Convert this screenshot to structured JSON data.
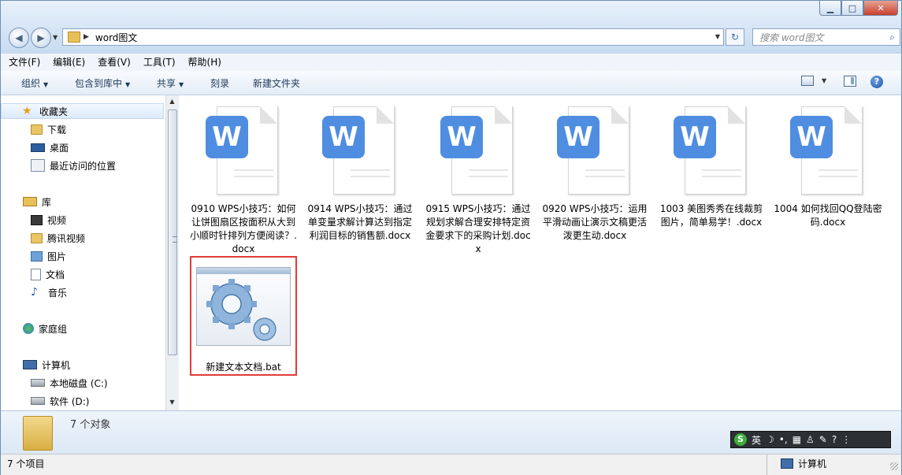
{
  "window": {
    "address": {
      "crumb": "word图文"
    },
    "search": {
      "placeholder": "搜索 word图文"
    }
  },
  "menu": [
    "文件(F)",
    "编辑(E)",
    "查看(V)",
    "工具(T)",
    "帮助(H)"
  ],
  "toolbar": {
    "organize": "组织",
    "include_library": "包含到库中",
    "share": "共享",
    "burn": "刻录",
    "new_folder": "新建文件夹"
  },
  "nav": {
    "favorites": "收藏夹",
    "downloads": "下载",
    "desktop": "桌面",
    "recent": "最近访问的位置",
    "libraries": "库",
    "videos": "视频",
    "tencent_video": "腾讯视频",
    "pictures": "图片",
    "documents": "文档",
    "music": "音乐",
    "homegroup": "家庭组",
    "computer": "计算机",
    "local_disk": "本地磁盘 (C:)",
    "software": "软件 (D:)"
  },
  "files": [
    {
      "name": "0910 WPS小技巧：如何让饼图扇区按面积从大到小顺时针排列方便阅读？.docx",
      "icon": "wps-word-icon"
    },
    {
      "name": "0914  WPS小技巧：通过单变量求解计算达到指定利润目标的销售额.docx",
      "icon": "wps-word-icon"
    },
    {
      "name": "0915 WPS小技巧：通过规划求解合理安排特定资金要求下的采购计划.docx",
      "icon": "wps-word-icon"
    },
    {
      "name": "0920 WPS小技巧：运用平滑动画让演示文稿更活泼更生动.docx",
      "icon": "wps-word-icon"
    },
    {
      "name": "1003 美图秀秀在线裁剪图片，简单易学！.docx",
      "icon": "wps-word-icon"
    },
    {
      "name": "1004 如何找回QQ登陆密码.docx",
      "icon": "wps-word-icon"
    }
  ],
  "selected_file": {
    "name": "新建文本文档.bat",
    "icon": "batch-gear-icon"
  },
  "details": {
    "count": "7 个对象"
  },
  "ime": {
    "lang": "英"
  },
  "status": {
    "items": "7 个项目",
    "location": "计算机"
  },
  "colors": {
    "word_icon": "#4f8de1",
    "selection_border": "#e33b3b"
  }
}
